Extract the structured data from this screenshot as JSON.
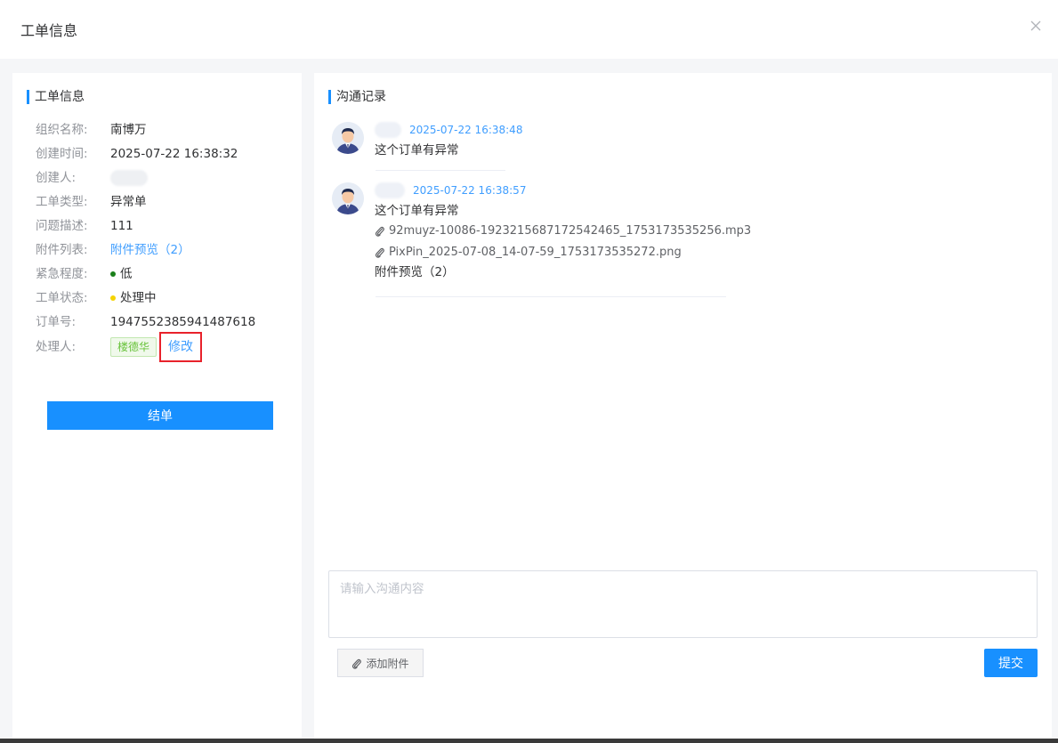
{
  "header": {
    "title": "工单信息"
  },
  "info": {
    "section_title": "工单信息",
    "rows": [
      {
        "label": "组织名称:",
        "value": "南博万"
      },
      {
        "label": "创建时间:",
        "value": "2025-07-22 16:38:32"
      },
      {
        "label": "创建人:",
        "value": ""
      },
      {
        "label": "工单类型:",
        "value": "异常单"
      },
      {
        "label": "问题描述:",
        "value": "111"
      },
      {
        "label": "附件列表:",
        "value": "附件预览（2）"
      },
      {
        "label": "紧急程度:",
        "value": "低"
      },
      {
        "label": "工单状态:",
        "value": "处理中"
      },
      {
        "label": "订单号:",
        "value": "1947552385941487618"
      },
      {
        "label": "处理人:",
        "value": "楼德华"
      }
    ],
    "edit_label": "修改",
    "finish_label": "结单",
    "colors": {
      "urgency_low": "#1a7f1a",
      "status_processing": "#f5d300"
    }
  },
  "chat": {
    "section_title": "沟通记录",
    "messages": [
      {
        "time": "2025-07-22 16:38:48",
        "text": "这个订单有异常",
        "files": [],
        "preview": ""
      },
      {
        "time": "2025-07-22 16:38:57",
        "text": "这个订单有异常",
        "files": [
          "92muyz-10086-1923215687172542465_1753173535256.mp3",
          "PixPin_2025-07-08_14-07-59_1753173535272.png"
        ],
        "preview": "附件预览（2）"
      }
    ],
    "input_placeholder": "请输入沟通内容",
    "attach_label": "添加附件",
    "submit_label": "提交"
  }
}
